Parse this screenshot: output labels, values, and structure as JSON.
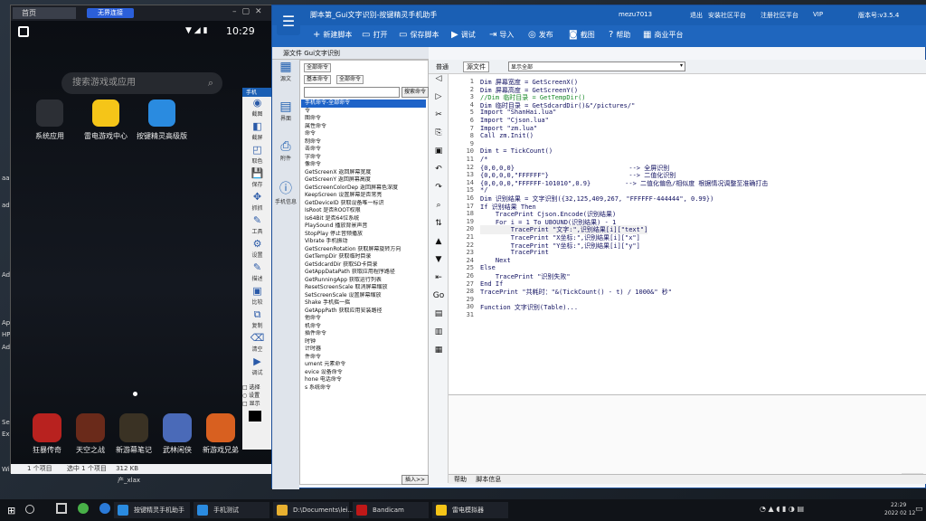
{
  "desktop": {
    "left_labels": [
      "aa",
      "ad",
      "Ad",
      "Ap",
      "HP",
      "Ad",
      "Se",
      "Ex",
      "Winfo"
    ]
  },
  "emulator": {
    "tab": "首页",
    "vip": "无界连接",
    "status_time": "10:29",
    "search_placeholder": "搜索游戏或应用",
    "apps": [
      {
        "label": "系统应用",
        "color": "#2c2f35"
      },
      {
        "label": "雷电游戏中心",
        "color": "#f5c518"
      },
      {
        "label": "按键精灵高级版",
        "color": "#2a8be0"
      }
    ],
    "dock": [
      {
        "label": "狂暴传奇",
        "color": "#b8221f"
      },
      {
        "label": "天空之战",
        "color": "#6a2a1a"
      },
      {
        "label": "新游幕笔记",
        "color": "#3a3224"
      },
      {
        "label": "武林闲侠",
        "color": "#4a6ab8"
      },
      {
        "label": "新游戏兄弟",
        "color": "#d86020"
      }
    ],
    "bottom": [
      "1 个项目",
      "选中 1 个项目",
      "312 KB"
    ],
    "bottom2": "产_xlax"
  },
  "mid_tools": [
    "截图",
    "截屏",
    "取色",
    "保存",
    "抓抓",
    "工具",
    "设置",
    "描述",
    "比较",
    "复制",
    "清空",
    "调试"
  ],
  "mid_labels": [
    "□ 选择",
    "○ 设置",
    "□ 显示"
  ],
  "app": {
    "title": "脚本第_Gui文字识别-按键精灵手机助手",
    "user": "mezu7013",
    "links": [
      "退出",
      "安装社区平台",
      "注册社区平台"
    ],
    "badge": "VIP",
    "version": "版本号:v3.5.4",
    "toolbar": [
      "新建脚本",
      "打开",
      "保存脚本",
      "调试",
      "导入",
      "发布",
      "截图",
      "帮助",
      "商业平台"
    ],
    "left_head": "源文件  Gui文字识别",
    "side": [
      "源文",
      "界面",
      "附件",
      "手机信息"
    ],
    "cmd_tabs": [
      "全部命令",
      "基本命令",
      "全部命令"
    ],
    "search_btn": "搜索命令",
    "cmds": [
      "手机命令-全部命令",
      "令",
      "图命令",
      "属性命令",
      "命令",
      "制命令",
      "击命令",
      "字命令",
      "像命令",
      "GetScreenX 返回屏幕宽度",
      "GetScreenY 返回屏幕高度",
      "GetScreenColorDep 返回屏幕色深度",
      "KeepScreen 设置屏幕是否常亮",
      "GetDeviceID 获取设备唯一标识",
      "IsRoot 是否ROOT权限",
      "Is64Bit 是否64位系统",
      "PlaySound 播放背景声音",
      "StopPlay 停止音频播放",
      "Vibrate 手机振动",
      "GetScreenRotation 获取屏幕旋转方向",
      "GetTempDir 获取临时目录",
      "GetSdcardDir 获取SD卡目录",
      "GetAppDataPath 获取应用程序路径",
      "GetRunningApp 获取运行列表",
      "ResetScreenScale 取消屏幕缩放",
      "SetScreenScale 设置屏幕缩放",
      "Shake 手机摇一摇",
      "GetAppPath 获取应用安装路径",
      "他命令",
      "机命令",
      "插件命令",
      "时钟",
      "计时器",
      "件命令",
      "ument 元素命令",
      "evice 设备命令",
      "hone 电话命令",
      "s 系统命令"
    ],
    "insert_btn": "插入>>",
    "editor_tabs": [
      "普通",
      "源文件"
    ],
    "editor_select": "显示全部",
    "code": [
      "Dim 屏幕宽度 = GetScreenX()",
      "Dim 屏幕高度 = GetScreenY()",
      "//Dim 临时目录 = GetTempDir()",
      "Dim 临时目录 = GetSdcardDir()&\"/pictures/\"",
      "Import \"ShanHai.lua\"",
      "Import \"Cjson.lua\"",
      "Import \"zm.lua\"",
      "Call zm.Init()",
      "",
      "Dim t = TickCount()",
      "/*",
      "{0,0,0,0}                              --> 全屏识别",
      "{0,0,0,0,\"FFFFFF\"}                     --> 二值化识别",
      "{0,0,0,0,\"FFFFFF-101010\",0.9}         --> 二值化偏色/相似度 根据情况调整至准确打击",
      "*/",
      "Dim 识别结果 = 文字识别({32,125,409,267, \"FFFFFF-444444\", 0.99})",
      "If 识别结果 Then",
      "    TracePrint Cjson.Encode(识别结果)",
      "    For i = 1 To UBOUND(识别结果) - 1",
      "        TracePrint \"文字:\",识别结果[i][\"text\"]",
      "        TracePrint \"X坐标:\",识别结果[i][\"x\"]",
      "        TracePrint \"Y坐标:\",识别结果[i][\"y\"]",
      "        TracePrint",
      "    Next",
      "Else",
      "    TracePrint \"识别失败\"",
      "End If",
      "TracePrint \"共耗时：\"&(TickCount() - t) / 1000&\" 秒\"",
      "",
      "Function 文字识别(Table)...",
      ""
    ],
    "out_tabs": [
      "帮助",
      "脚本信息"
    ]
  },
  "taskbar": {
    "items": [
      {
        "label": "按键精灵手机助手",
        "color": "#2a8be0"
      },
      {
        "label": "手机测试",
        "color": "#2a8be0"
      },
      {
        "label": "D:\\Documents\\lei...",
        "color": "#e8b030"
      },
      {
        "label": "Bandicam",
        "color": "#c01818"
      },
      {
        "label": "雷电模拟器",
        "color": "#f5c518"
      }
    ],
    "time": "22:29",
    "date": "2022 02 12"
  }
}
